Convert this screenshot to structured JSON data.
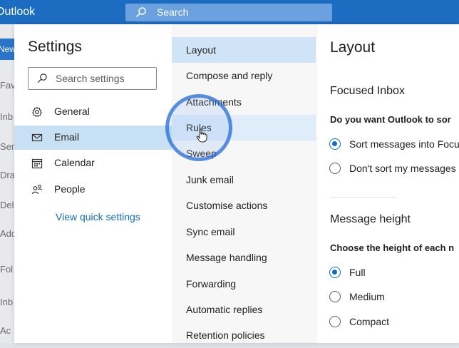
{
  "app": {
    "title": "Outlook",
    "search_placeholder": "Search"
  },
  "underlay": {
    "new_label": "New",
    "items": [
      "Fav",
      "Inb",
      "Sen",
      "Dra",
      "Del",
      "Add",
      "Fol",
      "Inb",
      "Ac"
    ]
  },
  "settings": {
    "title": "Settings",
    "search_placeholder": "Search settings",
    "nav": [
      {
        "label": "General",
        "icon": "gear-icon"
      },
      {
        "label": "Email",
        "icon": "mail-icon",
        "selected": true
      },
      {
        "label": "Calendar",
        "icon": "calendar-icon"
      },
      {
        "label": "People",
        "icon": "people-icon"
      }
    ],
    "quick_settings_link": "View quick settings"
  },
  "email_menu": {
    "items": [
      "Layout",
      "Compose and reply",
      "Attachments",
      "Rules",
      "Sweep",
      "Junk email",
      "Customise actions",
      "Sync email",
      "Message handling",
      "Forwarding",
      "Automatic replies",
      "Retention policies"
    ],
    "active": "Layout",
    "hovered": "Rules"
  },
  "layout_pane": {
    "title": "Layout",
    "focused_inbox": {
      "heading": "Focused Inbox",
      "question": "Do you want Outlook to sor",
      "options": [
        {
          "label": "Sort messages into Focu",
          "checked": true
        },
        {
          "label": "Don't sort my messages",
          "checked": false
        }
      ]
    },
    "message_height": {
      "heading": "Message height",
      "question": "Choose the height of each n",
      "options": [
        {
          "label": "Full",
          "checked": true
        },
        {
          "label": "Medium",
          "checked": false
        },
        {
          "label": "Compact",
          "checked": false
        }
      ]
    }
  },
  "colors": {
    "brand": "#1c6cc2",
    "accent": "#0f6cbd",
    "selection": "#c7e0f4"
  }
}
